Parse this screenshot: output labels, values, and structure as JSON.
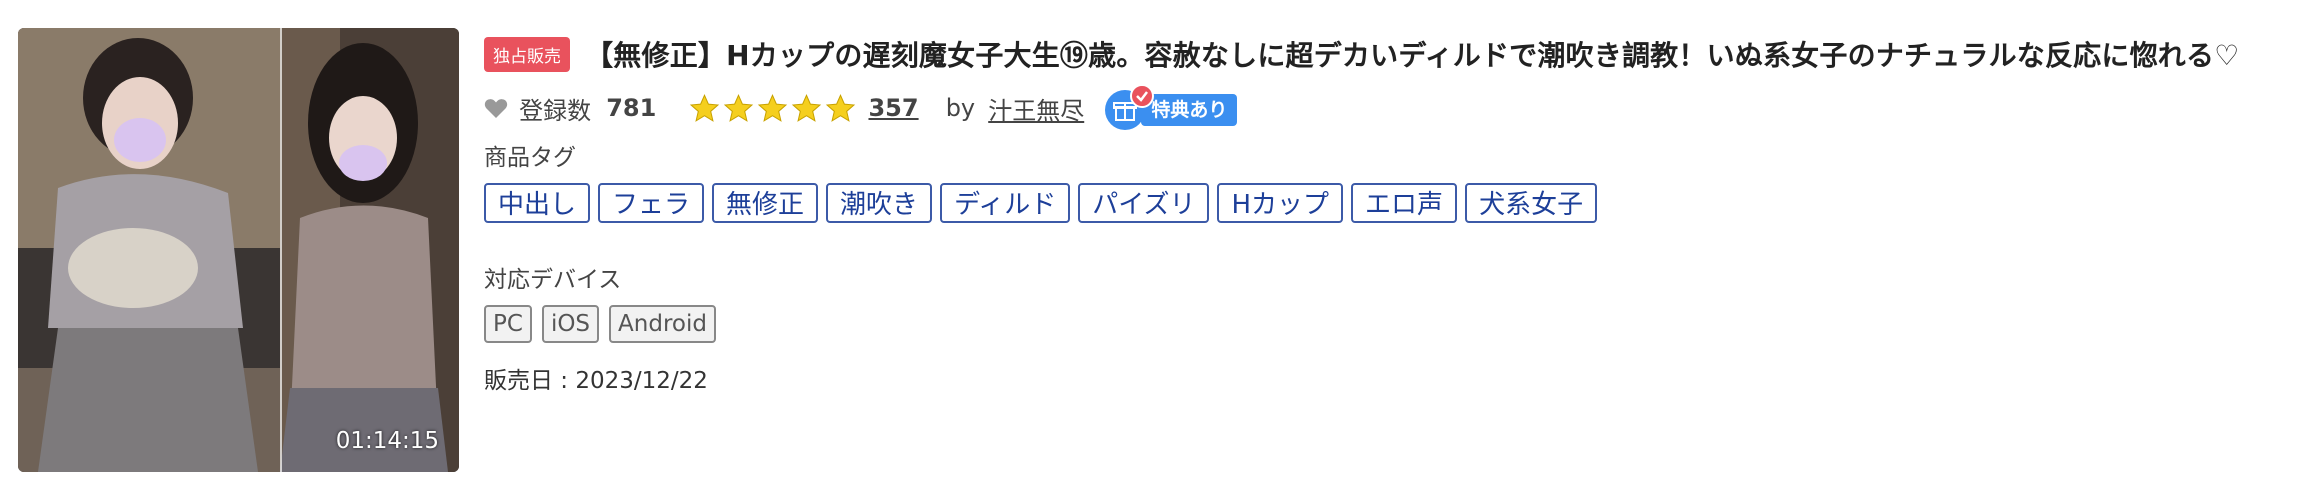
{
  "product": {
    "thumbnail": {
      "duration": "01:14:15",
      "description_icon": "product-thumbnail"
    },
    "exclusive_badge": "独占販売",
    "title": "【無修正】Hカップの遅刻魔女子大生⑲歳。容赦なしに超デカいディルドで潮吹き調教！いぬ系女子のナチュラルな反応に惚れる♡",
    "favorites": {
      "icon": "heart-icon",
      "label": "登録数",
      "count": "781"
    },
    "rating": {
      "stars": 5,
      "max": 5,
      "star_color": "#f5cf1e",
      "review_count": "357"
    },
    "seller": {
      "by": "by",
      "name": "汁王無尽"
    },
    "perk": {
      "icon": "gift-icon",
      "label": "特典あり",
      "color": "#3b8ff0"
    },
    "tags_label": "商品タグ",
    "tags": [
      "中出し",
      "フェラ",
      "無修正",
      "潮吹き",
      "ディルド",
      "パイズリ",
      "Hカップ",
      "エロ声",
      "犬系女子"
    ],
    "devices_label": "対応デバイス",
    "devices": [
      "PC",
      "iOS",
      "Android"
    ],
    "release": "販売日 : 2023/12/22",
    "colors": {
      "exclusive_badge": "#e9525d",
      "tag_text": "#1d3f99",
      "tag_border": "#3c5aa8"
    }
  }
}
